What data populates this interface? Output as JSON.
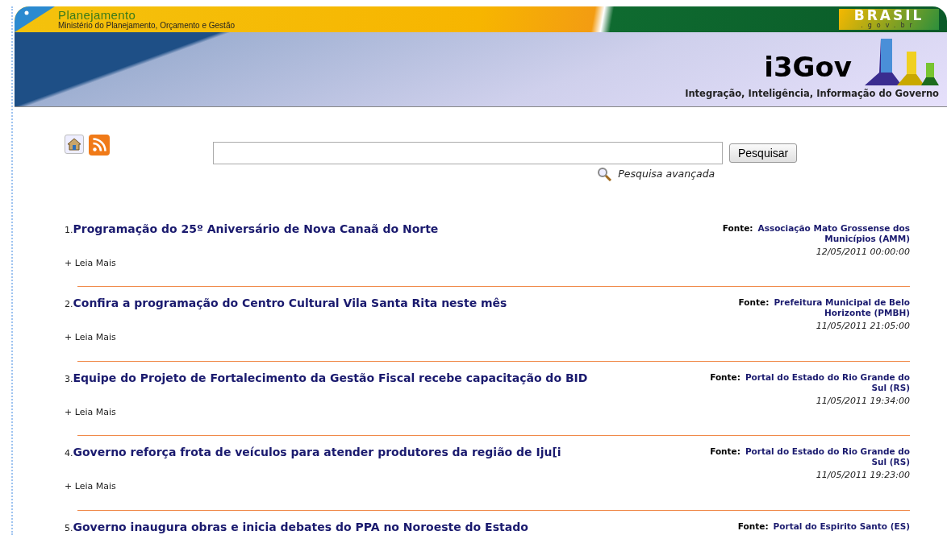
{
  "header": {
    "ministry": "Planejamento",
    "ministry_full": "Ministério do Planejamento, Orçamento e Gestão",
    "portal_logo": "BRASIL",
    "portal_domain": ".gov.br",
    "app_name": "i3Gov",
    "tagline": "Integração, Inteligência, Informação do Governo"
  },
  "search": {
    "button": "Pesquisar",
    "advanced": "Pesquisa avançada"
  },
  "news": [
    {
      "number": "1.",
      "title": "Programação do 25º Aniversário de Nova Canaã do Norte",
      "source_label": "Fonte:",
      "source": "Associação Mato Grossense dos Municípios (AMM)",
      "more": "+ Leia Mais",
      "date": "12/05/2011 00:00:00"
    },
    {
      "number": "2.",
      "title": "Confira a programação do Centro Cultural Vila Santa Rita neste mês",
      "source_label": "Fonte:",
      "source": "Prefeitura Municipal de Belo Horizonte (PMBH)",
      "more": "+ Leia Mais",
      "date": "11/05/2011 21:05:00"
    },
    {
      "number": "3.",
      "title": "Equipe do Projeto de Fortalecimento da Gestão Fiscal recebe capacitação do BID",
      "source_label": "Fonte:",
      "source": "Portal do Estado do Rio Grande do Sul (RS)",
      "more": "+ Leia Mais",
      "date": "11/05/2011 19:34:00"
    },
    {
      "number": "4.",
      "title": "Governo reforça frota de veículos para atender produtores da região de Iju[i",
      "source_label": "Fonte:",
      "source": "Portal do Estado do Rio Grande do Sul (RS)",
      "more": "+ Leia Mais",
      "date": "11/05/2011 19:23:00"
    },
    {
      "number": "5.",
      "title": "Governo inaugura obras e inicia debates do PPA no Noroeste do Estado",
      "source_label": "Fonte:",
      "source": "Portal do Espirito Santo (ES)"
    }
  ]
}
